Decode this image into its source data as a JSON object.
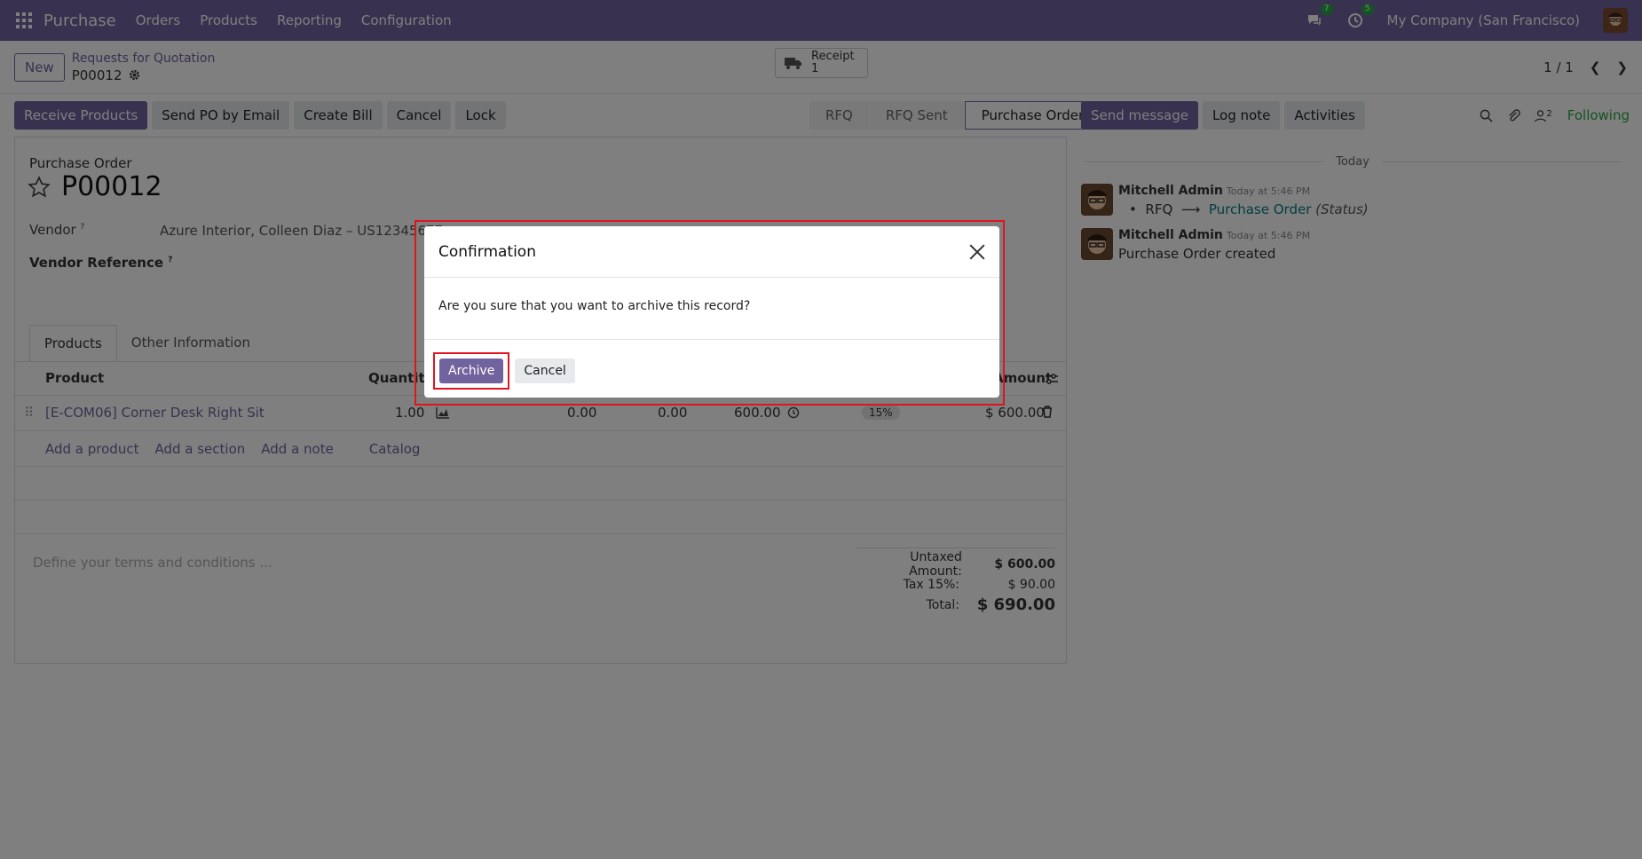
{
  "navbar": {
    "brand": "Purchase",
    "menu": [
      "Orders",
      "Products",
      "Reporting",
      "Configuration"
    ],
    "messages_badge": "7",
    "activities_badge": "5",
    "company": "My Company (San Francisco)"
  },
  "control": {
    "new_label": "New",
    "breadcrumb_parent": "Requests for Quotation",
    "breadcrumb_current": "P00012",
    "receipt_label": "Receipt",
    "receipt_count": "1",
    "pager": "1 / 1"
  },
  "actions": [
    "Receive Products",
    "Send PO by Email",
    "Create Bill",
    "Cancel",
    "Lock"
  ],
  "status_stages": [
    "RFQ",
    "RFQ Sent",
    "Purchase Order"
  ],
  "chatter": {
    "send_message": "Send message",
    "log_note": "Log note",
    "activities": "Activities",
    "followers_count": "2",
    "following": "Following",
    "today": "Today",
    "messages": [
      {
        "author": "Mitchell Admin",
        "time": "Today at 5:46 PM",
        "from": "RFQ",
        "to": "Purchase Order",
        "field": "(Status)"
      },
      {
        "author": "Mitchell Admin",
        "time": "Today at 5:46 PM",
        "body": "Purchase Order created"
      }
    ]
  },
  "form": {
    "label": "Purchase Order",
    "title": "P00012",
    "vendor_label": "Vendor",
    "vendor_value": "Azure Interior, Colleen Diaz – US12345677",
    "vendor_ref_label": "Vendor Reference",
    "tabs": [
      "Products",
      "Other Information"
    ],
    "columns": {
      "product": "Product",
      "quantity": "Quantity",
      "amount": "Amount"
    },
    "line": {
      "product": "[E-COM06] Corner Desk Right Sit",
      "quantity": "1.00",
      "received": "0.00",
      "billed": "0.00",
      "unit_price": "600.00",
      "tax": "15%",
      "amount": "$ 600.00"
    },
    "add_links": [
      "Add a product",
      "Add a section",
      "Add a note",
      "Catalog"
    ],
    "terms_placeholder": "Define your terms and conditions ...",
    "totals": [
      {
        "k": "Untaxed Amount:",
        "v": "$ 600.00"
      },
      {
        "k": "Tax 15%:",
        "v": "$ 90.00"
      },
      {
        "k": "Total:",
        "v": "$ 690.00"
      }
    ]
  },
  "dialog": {
    "title": "Confirmation",
    "message": "Are you sure that you want to archive this record?",
    "confirm": "Archive",
    "cancel": "Cancel"
  }
}
